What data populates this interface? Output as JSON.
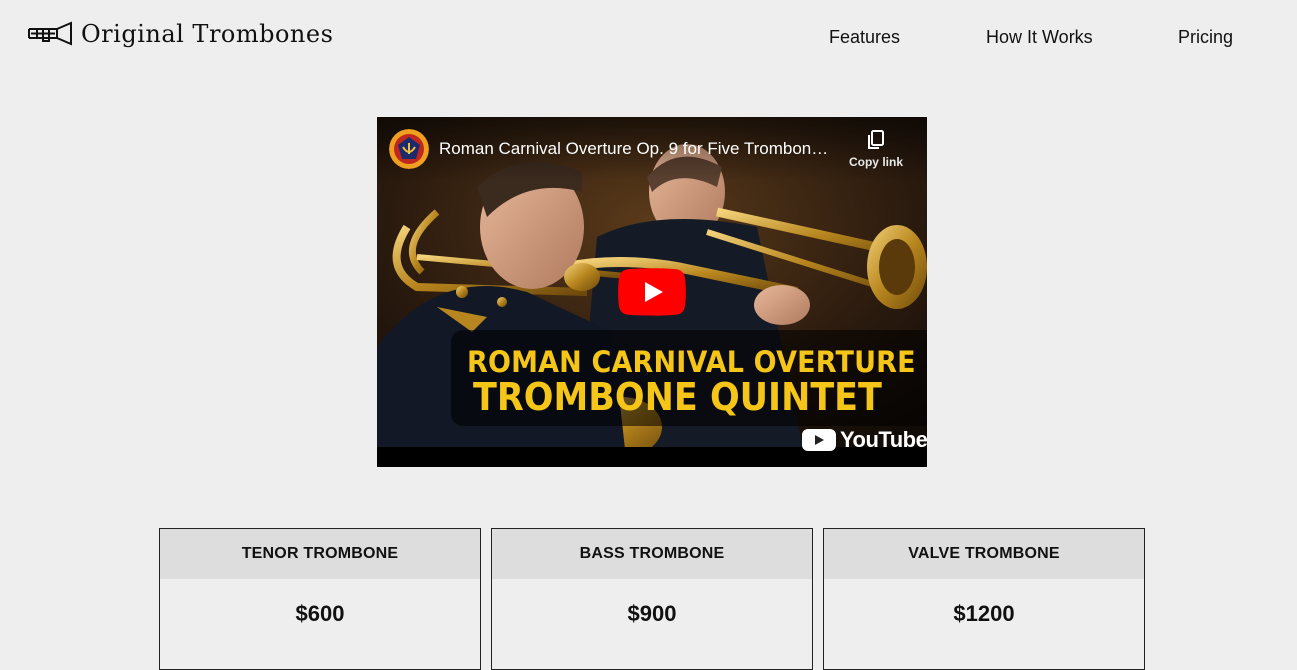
{
  "brand": {
    "name": "Original Trombones",
    "icon": "trombone-icon"
  },
  "nav": {
    "items": [
      {
        "label": "Features"
      },
      {
        "label": "How It Works"
      },
      {
        "label": "Pricing"
      }
    ]
  },
  "video": {
    "title": "Roman Carnival Overture Op. 9 for Five Trombon…",
    "copy_link_label": "Copy link",
    "caption_line1": "ROMAN CARNIVAL OVERTURE",
    "caption_line2": "TROMBONE QUINTET",
    "platform": "YouTube",
    "colors": {
      "play_button": "#ff0000",
      "caption": "#f5c518"
    }
  },
  "pricing": {
    "cards": [
      {
        "name": "TENOR TROMBONE",
        "price": "$600"
      },
      {
        "name": "BASS TROMBONE",
        "price": "$900"
      },
      {
        "name": "VALVE TROMBONE",
        "price": "$1200"
      }
    ]
  }
}
